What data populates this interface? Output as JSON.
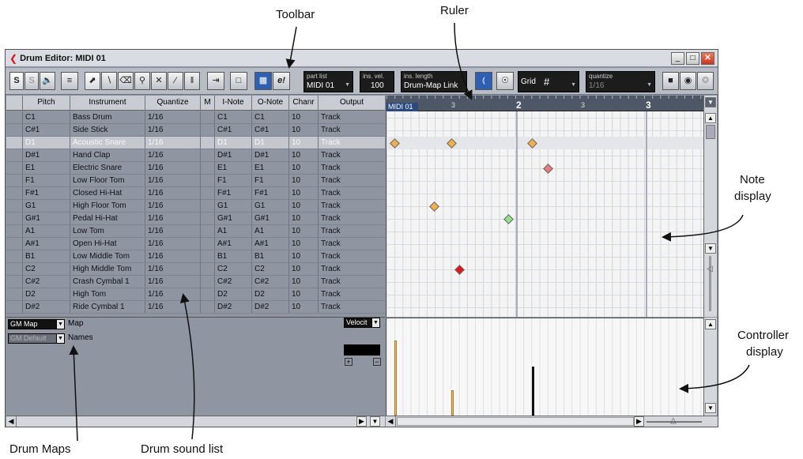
{
  "annotations": {
    "toolbar": "Toolbar",
    "ruler": "Ruler",
    "note_display_1": "Note",
    "note_display_2": "display",
    "controller_display_1": "Controller",
    "controller_display_2": "display",
    "drum_maps": "Drum Maps",
    "drum_sound_list": "Drum sound list"
  },
  "window": {
    "title": "Drum Editor: MIDI 01"
  },
  "toolbar": {
    "solo": "S",
    "listen": "S",
    "part_list_label": "part list",
    "part_list_value": "MIDI 01",
    "ins_vel_label": "ins. vel.",
    "ins_vel_value": "100",
    "ins_length_label": "ins. length",
    "ins_length_value": "Drum-Map Link",
    "grid_label": "Grid",
    "quantize_label": "quantize",
    "quantize_value": "1/16",
    "edit_icon_label": "e!"
  },
  "columns": [
    "Pitch",
    "Instrument",
    "Quantize",
    "M",
    "I-Note",
    "O-Note",
    "Chanr",
    "Output"
  ],
  "rows": [
    {
      "pitch": "C1",
      "instrument": "Bass Drum",
      "quantize": "1/16",
      "inote": "C1",
      "onote": "C1",
      "channel": "10",
      "output": "Track"
    },
    {
      "pitch": "C#1",
      "instrument": "Side Stick",
      "quantize": "1/16",
      "inote": "C#1",
      "onote": "C#1",
      "channel": "10",
      "output": "Track"
    },
    {
      "pitch": "D1",
      "instrument": "Acoustic Snare",
      "quantize": "1/16",
      "inote": "D1",
      "onote": "D1",
      "channel": "10",
      "output": "Track"
    },
    {
      "pitch": "D#1",
      "instrument": "Hand Clap",
      "quantize": "1/16",
      "inote": "D#1",
      "onote": "D#1",
      "channel": "10",
      "output": "Track"
    },
    {
      "pitch": "E1",
      "instrument": "Electric Snare",
      "quantize": "1/16",
      "inote": "E1",
      "onote": "E1",
      "channel": "10",
      "output": "Track"
    },
    {
      "pitch": "F1",
      "instrument": "Low Floor Tom",
      "quantize": "1/16",
      "inote": "F1",
      "onote": "F1",
      "channel": "10",
      "output": "Track"
    },
    {
      "pitch": "F#1",
      "instrument": "Closed Hi-Hat",
      "quantize": "1/16",
      "inote": "F#1",
      "onote": "F#1",
      "channel": "10",
      "output": "Track"
    },
    {
      "pitch": "G1",
      "instrument": "High Floor Tom",
      "quantize": "1/16",
      "inote": "G1",
      "onote": "G1",
      "channel": "10",
      "output": "Track"
    },
    {
      "pitch": "G#1",
      "instrument": "Pedal Hi-Hat",
      "quantize": "1/16",
      "inote": "G#1",
      "onote": "G#1",
      "channel": "10",
      "output": "Track"
    },
    {
      "pitch": "A1",
      "instrument": "Low Tom",
      "quantize": "1/16",
      "inote": "A1",
      "onote": "A1",
      "channel": "10",
      "output": "Track"
    },
    {
      "pitch": "A#1",
      "instrument": "Open Hi-Hat",
      "quantize": "1/16",
      "inote": "A#1",
      "onote": "A#1",
      "channel": "10",
      "output": "Track"
    },
    {
      "pitch": "B1",
      "instrument": "Low Middle Tom",
      "quantize": "1/16",
      "inote": "B1",
      "onote": "B1",
      "channel": "10",
      "output": "Track"
    },
    {
      "pitch": "C2",
      "instrument": "High Middle Tom",
      "quantize": "1/16",
      "inote": "C2",
      "onote": "C2",
      "channel": "10",
      "output": "Track"
    },
    {
      "pitch": "C#2",
      "instrument": "Crash Cymbal 1",
      "quantize": "1/16",
      "inote": "C#2",
      "onote": "C#2",
      "channel": "10",
      "output": "Track"
    },
    {
      "pitch": "D2",
      "instrument": "High Tom",
      "quantize": "1/16",
      "inote": "D2",
      "onote": "D2",
      "channel": "10",
      "output": "Track"
    },
    {
      "pitch": "D#2",
      "instrument": "Ride Cymbal 1",
      "quantize": "1/16",
      "inote": "D#2",
      "onote": "D#2",
      "channel": "10",
      "output": "Track"
    }
  ],
  "selected_row": "D1",
  "drum_map": {
    "map_value": "GM Map",
    "map_label": "Map",
    "names_value": "GM Default",
    "names_label": "Names"
  },
  "controller": {
    "lane_value": "Velocit"
  },
  "ruler": {
    "part": "MIDI 01",
    "marks": [
      "3",
      "2",
      "3",
      "3"
    ]
  },
  "colors": {
    "note_orange": "#f0b050",
    "note_pink": "#e87a80",
    "note_green": "#8fe08a",
    "note_red": "#e01818",
    "accent_blue": "#2f5fb0"
  }
}
